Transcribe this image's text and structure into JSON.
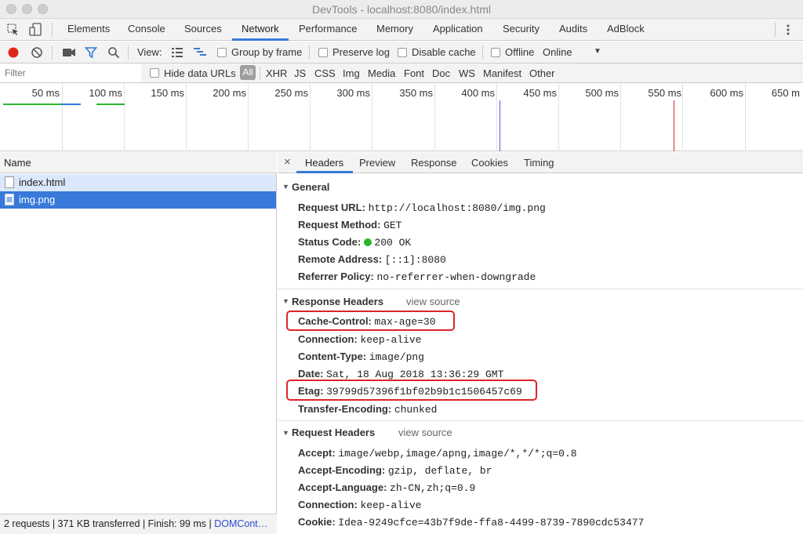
{
  "window": {
    "title": "DevTools - localhost:8080/index.html"
  },
  "main_tabs": [
    "Elements",
    "Console",
    "Sources",
    "Network",
    "Performance",
    "Memory",
    "Application",
    "Security",
    "Audits",
    "AdBlock"
  ],
  "active_main_tab": "Network",
  "toolbar": {
    "view_label": "View:",
    "group_by_frame": "Group by frame",
    "preserve_log": "Preserve log",
    "disable_cache": "Disable cache",
    "offline": "Offline",
    "throttle": "Online"
  },
  "filter": {
    "placeholder": "Filter",
    "hide_data_urls": "Hide data URLs",
    "types": [
      "All",
      "XHR",
      "JS",
      "CSS",
      "Img",
      "Media",
      "Font",
      "Doc",
      "WS",
      "Manifest",
      "Other"
    ]
  },
  "timeline": {
    "ticks": [
      "50 ms",
      "100 ms",
      "150 ms",
      "200 ms",
      "250 ms",
      "300 ms",
      "350 ms",
      "400 ms",
      "450 ms",
      "500 ms",
      "550 ms",
      "600 ms",
      "650 m"
    ]
  },
  "requests": {
    "column_name": "Name",
    "rows": [
      "index.html",
      "img.png"
    ],
    "selected": "img.png",
    "status": "2 requests | 371 KB transferred | Finish: 99 ms | ",
    "status_link": "DOMCont…"
  },
  "detail": {
    "close": "×",
    "tabs": [
      "Headers",
      "Preview",
      "Response",
      "Cookies",
      "Timing"
    ],
    "active_tab": "Headers",
    "view_source": "view source",
    "general": {
      "title": "General",
      "items": [
        {
          "k": "Request URL:",
          "v": "http://localhost:8080/img.png"
        },
        {
          "k": "Request Method:",
          "v": "GET"
        },
        {
          "k": "Status Code:",
          "v": "200 OK"
        },
        {
          "k": "Remote Address:",
          "v": "[::1]:8080"
        },
        {
          "k": "Referrer Policy:",
          "v": "no-referrer-when-downgrade"
        }
      ]
    },
    "response_headers": {
      "title": "Response Headers",
      "items": [
        {
          "k": "Cache-Control:",
          "v": "max-age=30"
        },
        {
          "k": "Connection:",
          "v": "keep-alive"
        },
        {
          "k": "Content-Type:",
          "v": "image/png"
        },
        {
          "k": "Date:",
          "v": "Sat, 18 Aug 2018 13:36:29 GMT"
        },
        {
          "k": "Etag:",
          "v": "39799d57396f1bf02b9b1c1506457c69"
        },
        {
          "k": "Transfer-Encoding:",
          "v": "chunked"
        }
      ]
    },
    "request_headers": {
      "title": "Request Headers",
      "items": [
        {
          "k": "Accept:",
          "v": "image/webp,image/apng,image/*,*/*;q=0.8"
        },
        {
          "k": "Accept-Encoding:",
          "v": "gzip, deflate, br"
        },
        {
          "k": "Accept-Language:",
          "v": "zh-CN,zh;q=0.9"
        },
        {
          "k": "Connection:",
          "v": "keep-alive"
        },
        {
          "k": "Cookie:",
          "v": "Idea-9249cfce=43b7f9de-ffa8-4499-8739-7890cdc53477"
        }
      ]
    }
  },
  "colors": {
    "accent": "#3879d9",
    "selected_row": "#3879d9",
    "status_ok": "#2bb52b",
    "highlight": "#d9262a",
    "record": "#e0251b"
  }
}
